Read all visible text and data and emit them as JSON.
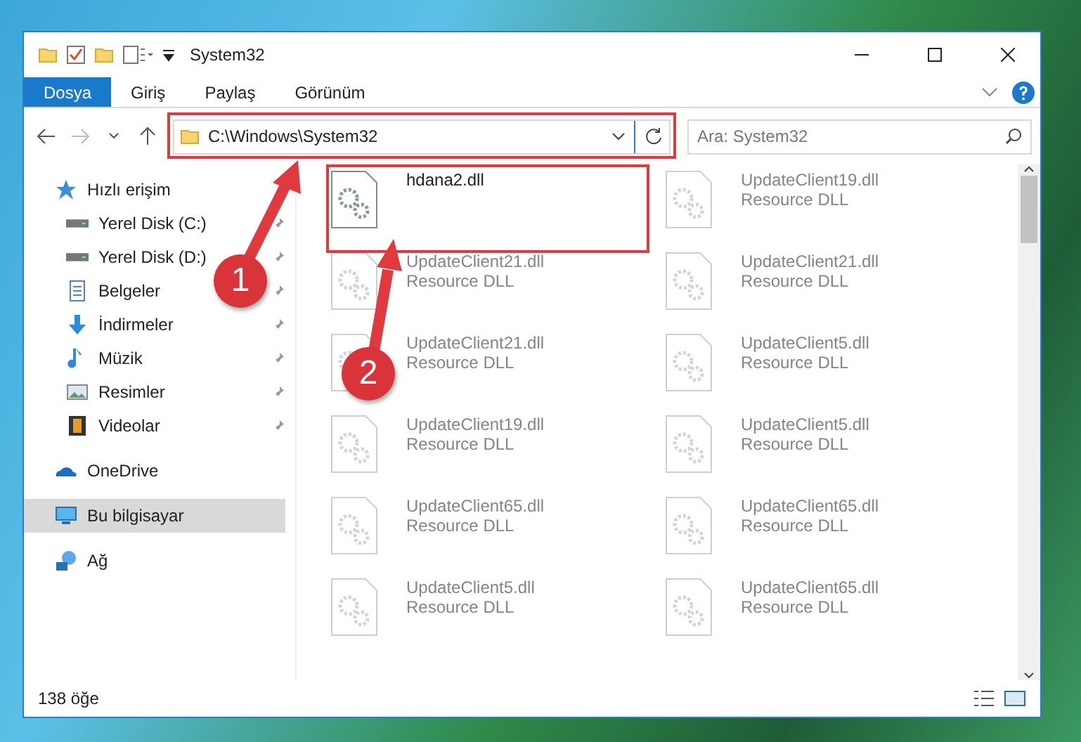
{
  "window": {
    "title": "System32"
  },
  "ribbon_tabs": [
    {
      "label": "Dosya",
      "selected": true
    },
    {
      "label": "Giriş",
      "selected": false
    },
    {
      "label": "Paylaş",
      "selected": false
    },
    {
      "label": "Görünüm",
      "selected": false
    }
  ],
  "address": {
    "path": "C:\\Windows\\System32"
  },
  "search": {
    "placeholder": "Ara: System32"
  },
  "sidebar": {
    "items": [
      {
        "label": "Hızlı erişim",
        "kind": "star",
        "selected": false,
        "children": [
          {
            "label": "Yerel Disk (C:)",
            "kind": "drive",
            "pinned": true,
            "selected": false
          },
          {
            "label": "Yerel Disk (D:)",
            "kind": "drive",
            "pinned": true,
            "selected": false
          },
          {
            "label": "Belgeler",
            "kind": "document",
            "pinned": true,
            "selected": false
          },
          {
            "label": "İndirmeler",
            "kind": "download",
            "pinned": true,
            "selected": false
          },
          {
            "label": "Müzik",
            "kind": "music",
            "pinned": true,
            "selected": false
          },
          {
            "label": "Resimler",
            "kind": "picture",
            "pinned": true,
            "selected": false
          },
          {
            "label": "Videolar",
            "kind": "video",
            "pinned": true,
            "selected": false
          }
        ]
      },
      {
        "label": "OneDrive",
        "kind": "cloud",
        "selected": false
      },
      {
        "label": "Bu bilgisayar",
        "kind": "computer",
        "selected": true
      },
      {
        "label": "Ağ",
        "kind": "network",
        "selected": false
      }
    ]
  },
  "files": [
    {
      "name": "hdana2.dll",
      "blurred": false,
      "highlighted": true
    },
    {
      "name": "UpdateClient19.dll",
      "type": "Resource DLL",
      "blurred": true
    },
    {
      "name": "UpdateClient21.dll",
      "type": "Resource DLL",
      "blurred": true
    },
    {
      "name": "UpdateClient21.dll",
      "type": "Resource DLL",
      "blurred": true
    },
    {
      "name": "UpdateClient21.dll",
      "type": "Resource DLL",
      "blurred": true
    },
    {
      "name": "UpdateClient5.dll",
      "type": "Resource DLL",
      "blurred": true
    },
    {
      "name": "UpdateClient19.dll",
      "type": "Resource DLL",
      "blurred": true
    },
    {
      "name": "UpdateClient5.dll",
      "type": "Resource DLL",
      "blurred": true
    },
    {
      "name": "UpdateClient65.dll",
      "type": "Resource DLL",
      "blurred": true
    },
    {
      "name": "UpdateClient65.dll",
      "type": "Resource DLL",
      "blurred": true
    },
    {
      "name": "UpdateClient5.dll",
      "type": "Resource DLL",
      "blurred": true
    },
    {
      "name": "UpdateClient65.dll",
      "type": "Resource DLL",
      "blurred": true
    }
  ],
  "status_bar": {
    "count": "138 öğe"
  },
  "annotations": [
    {
      "number": "1"
    },
    {
      "number": "2"
    }
  ]
}
